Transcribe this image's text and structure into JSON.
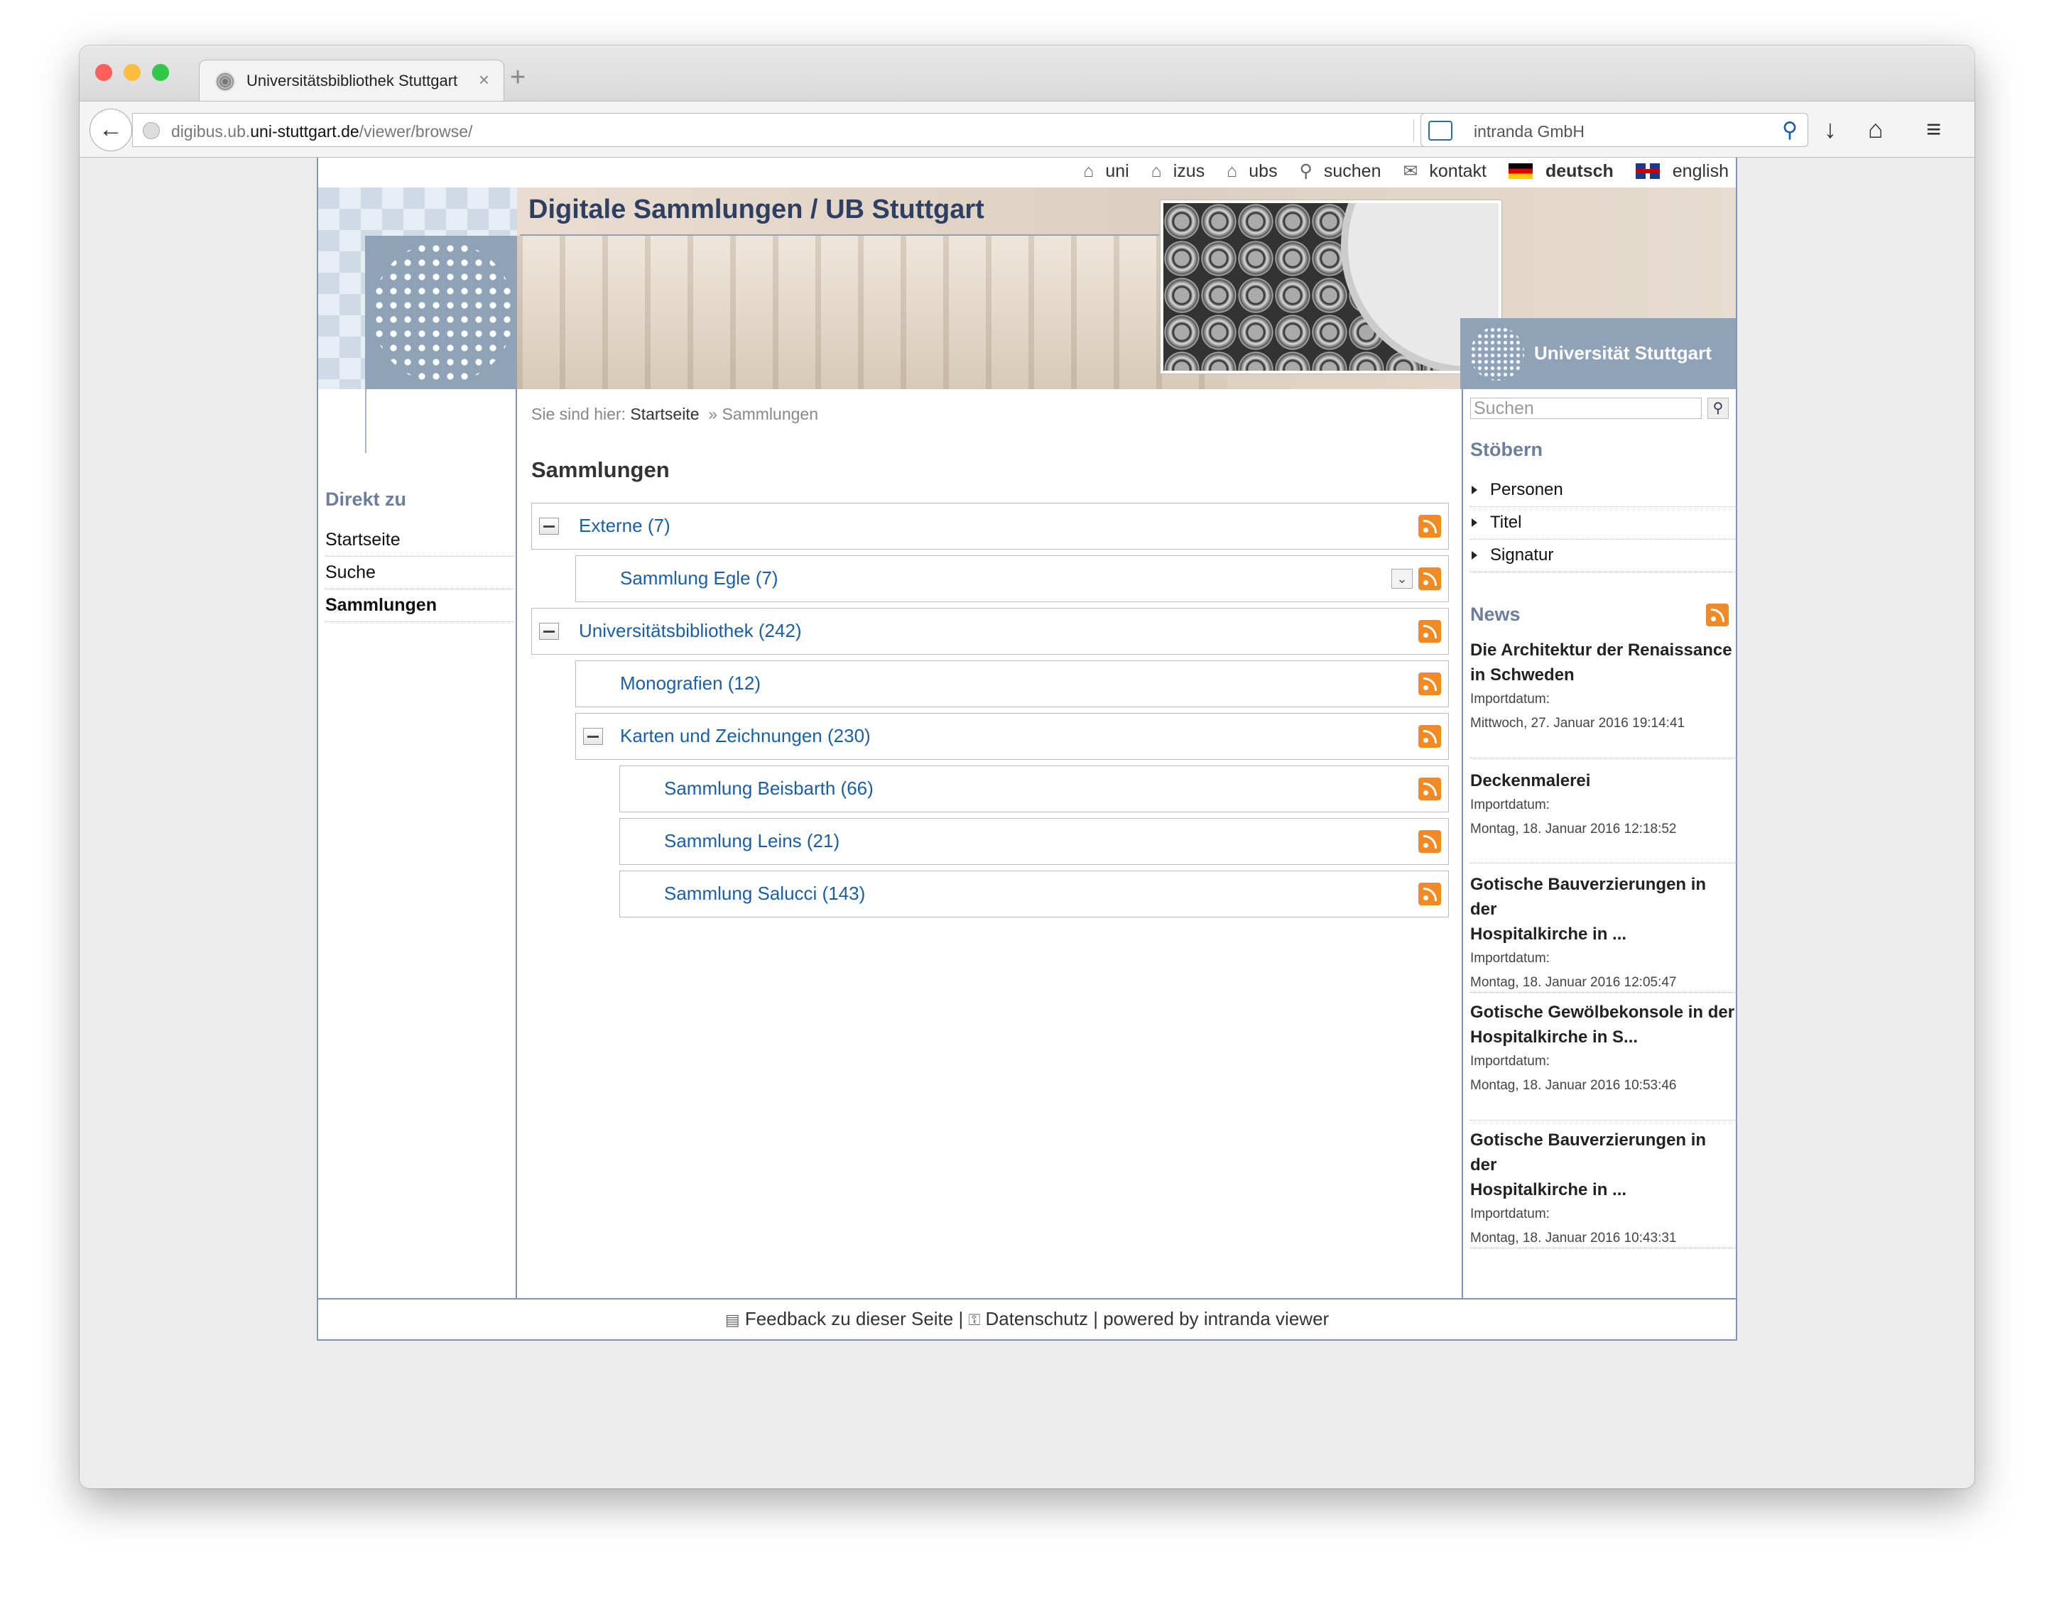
{
  "browser": {
    "tab_title": "Universitätsbibliothek Stuttgart",
    "url_prefix": "digibus.ub.",
    "url_domain": "uni-stuttgart.de",
    "url_path": "/viewer/browse/",
    "search_engine_text": "intranda GmbH",
    "colors": {
      "close": "#fc605b",
      "minimize": "#fdbc40",
      "zoom": "#34c84a"
    }
  },
  "topnav": {
    "uni": "uni",
    "izus": "izus",
    "ubs": "ubs",
    "suchen": "suchen",
    "kontakt": "kontakt",
    "deutsch": "deutsch",
    "english": "english"
  },
  "banner": {
    "title": "Digitale Sammlungen / UB Stuttgart",
    "university": "Universität Stuttgart"
  },
  "left": {
    "heading": "Direkt zu",
    "items": [
      "Startseite",
      "Suche",
      "Sammlungen"
    ]
  },
  "main": {
    "crumb_prefix": "Sie sind hier:",
    "crumb_start": "Startseite",
    "crumb_current": "» Sammlungen",
    "heading": "Sammlungen",
    "collections": [
      {
        "label": "Externe (7)",
        "level": 0,
        "expanded": true
      },
      {
        "label": "Sammlung Egle (7)",
        "level": 1,
        "dropdown": true
      },
      {
        "label": "Universitätsbibliothek (242)",
        "level": 0,
        "expanded": true
      },
      {
        "label": "Monografien (12)",
        "level": 1
      },
      {
        "label": "Karten und Zeichnungen (230)",
        "level": 1,
        "expanded": true
      },
      {
        "label": "Sammlung Beisbarth (66)",
        "level": 2
      },
      {
        "label": "Sammlung Leins (21)",
        "level": 2
      },
      {
        "label": "Sammlung Salucci (143)",
        "level": 2
      }
    ]
  },
  "right": {
    "search_placeholder": "Suchen",
    "browse_heading": "Stöbern",
    "browse_items": [
      "Personen",
      "Titel",
      "Signatur"
    ],
    "news_heading": "News",
    "news": [
      {
        "title1": "Die Architektur der Renaissance",
        "title2": "in Schweden",
        "label": "Importdatum:",
        "date": "Mittwoch, 27. Januar 2016 19:14:41"
      },
      {
        "title1": "Deckenmalerei",
        "title2": "",
        "label": "Importdatum:",
        "date": "Montag, 18. Januar 2016 12:18:52"
      },
      {
        "title1": "Gotische Bauverzierungen in der",
        "title2": "Hospitalkirche in ...",
        "label": "Importdatum:",
        "date": "Montag, 18. Januar 2016 12:05:47"
      },
      {
        "title1": "Gotische Gewölbekonsole in der",
        "title2": "Hospitalkirche in S...",
        "label": "Importdatum:",
        "date": "Montag, 18. Januar 2016 10:53:46"
      },
      {
        "title1": "Gotische Bauverzierungen in der",
        "title2": "Hospitalkirche in ...",
        "label": "Importdatum:",
        "date": "Montag, 18. Januar 2016 10:43:31"
      }
    ]
  },
  "footer": {
    "feedback": "Feedback zu dieser Seite",
    "sep": "|",
    "datenschutz": "Datenschutz",
    "powered": "powered by",
    "viewer": "intranda viewer"
  }
}
